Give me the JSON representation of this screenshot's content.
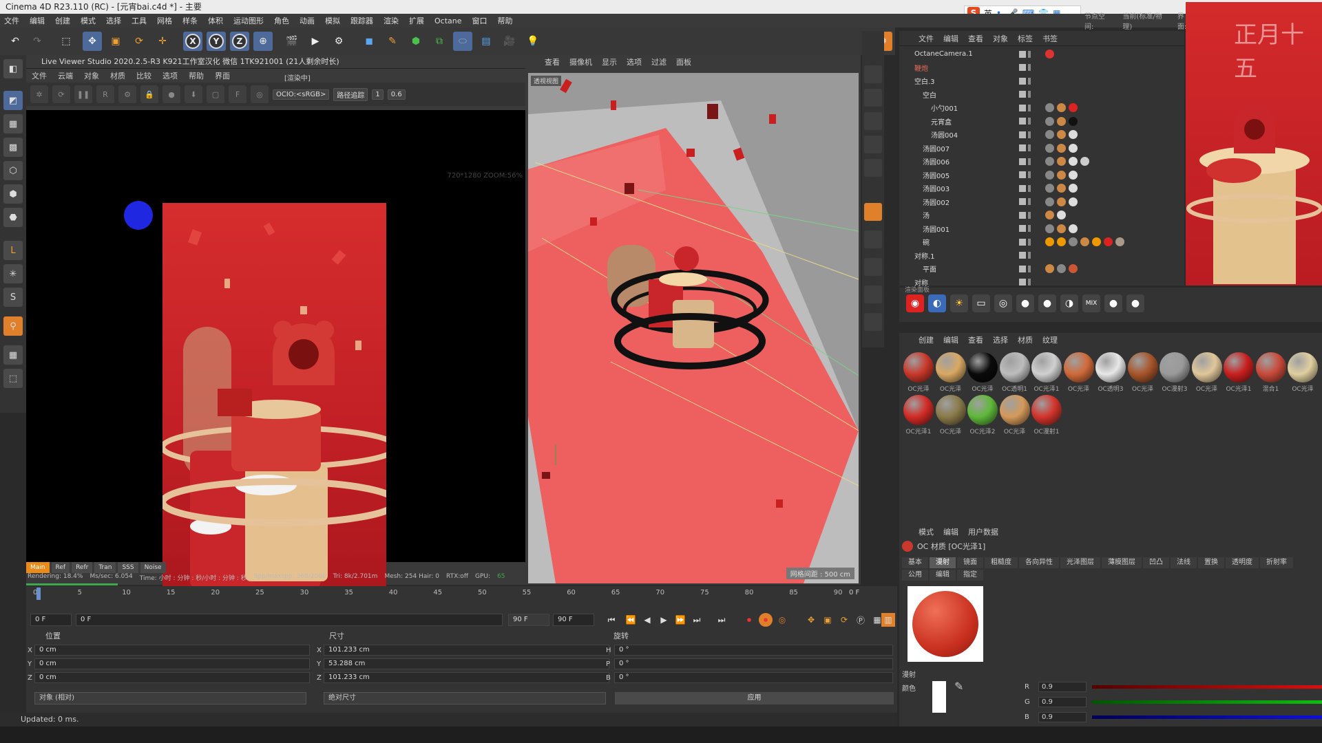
{
  "title": "Cinema 4D R23.110 (RC) - [元宵bai.c4d *] - 主要",
  "menu": [
    "文件",
    "编辑",
    "创建",
    "模式",
    "选择",
    "工具",
    "网格",
    "样条",
    "体积",
    "运动图形",
    "角色",
    "动画",
    "模拟",
    "跟踪器",
    "渲染",
    "扩展",
    "Octane",
    "窗口",
    "帮助"
  ],
  "ime": {
    "logo": "S",
    "lang": "英"
  },
  "top_right": [
    "节点空间:",
    "当前(标准/物理)",
    "界面:"
  ],
  "live_viewer": {
    "title": "Live Viewer Studio 2020.2.5-R3  K921工作室汉化 微信 1TK921001  (21人剩余时长)",
    "menu": [
      "文件",
      "云端",
      "对象",
      "材质",
      "比较",
      "选项",
      "帮助",
      "界面"
    ],
    "tag": "[渲染中]",
    "ocio": "OCIO:<sRGB>",
    "mode": "路径追踪",
    "v1": "1",
    "v2": "0.6",
    "zoom": "720*1280 ZOOM:56%",
    "tabs": [
      "Main",
      "Ref",
      "Refr",
      "Tran",
      "SSS",
      "Noise"
    ],
    "status": {
      "rendering": "Rendering: 18.4%",
      "mssec": "Ms/sec: 6.054",
      "time": "Time: 小时 : 分钟 : 秒/小时 : 分钟 : 秒",
      "spp": "Spp/maxspp: 368/2000",
      "tri": "Tri: 8k/2.701m",
      "mesh": "Mesh: 254 Hair: 0",
      "rtx": "RTX:off",
      "gpu": "GPU:",
      "gpu_val": "65"
    },
    "progress": 0.184
  },
  "viewport": {
    "menu": [
      "查看",
      "摄像机",
      "显示",
      "选项",
      "过滤",
      "面板"
    ],
    "label": "透视视图",
    "grid": "网格间距 : 500 cm"
  },
  "object_manager": {
    "menu": [
      "文件",
      "编辑",
      "查看",
      "对象",
      "标签",
      "书签"
    ],
    "rows": [
      {
        "name": "OctaneCamera.1",
        "indent": 0,
        "tags": [
          "#d33"
        ]
      },
      {
        "name": "鞭炮",
        "indent": 0,
        "tags": [],
        "color": "#e06a5a"
      },
      {
        "name": "空白.3",
        "indent": 0,
        "tags": []
      },
      {
        "name": "空白",
        "indent": 1,
        "tags": []
      },
      {
        "name": "小勺001",
        "indent": 2,
        "tags": [
          "#888",
          "#c84",
          "#d22"
        ]
      },
      {
        "name": "元宵盒",
        "indent": 2,
        "tags": [
          "#888",
          "#c84",
          "#111"
        ]
      },
      {
        "name": "汤圆004",
        "indent": 2,
        "tags": [
          "#888",
          "#c84",
          "#ddd"
        ]
      },
      {
        "name": "汤圆007",
        "indent": 1,
        "tags": [
          "#888",
          "#c84",
          "#ddd"
        ]
      },
      {
        "name": "汤圆006",
        "indent": 1,
        "tags": [
          "#888",
          "#c84",
          "#ddd",
          "#ccc"
        ]
      },
      {
        "name": "汤圆005",
        "indent": 1,
        "tags": [
          "#888",
          "#c84",
          "#ddd"
        ]
      },
      {
        "name": "汤圆003",
        "indent": 1,
        "tags": [
          "#888",
          "#c84",
          "#ddd"
        ]
      },
      {
        "name": "汤圆002",
        "indent": 1,
        "tags": [
          "#888",
          "#c84",
          "#ddd"
        ]
      },
      {
        "name": "汤",
        "indent": 1,
        "tags": [
          "#c84",
          "#ddd"
        ]
      },
      {
        "name": "汤圆001",
        "indent": 1,
        "tags": [
          "#888",
          "#c84",
          "#ddd"
        ]
      },
      {
        "name": "碗",
        "indent": 1,
        "tags": [
          "#e90",
          "#e90",
          "#888",
          "#c84",
          "#e90",
          "#d22",
          "#a98"
        ]
      },
      {
        "name": "对称.1",
        "indent": 0,
        "tags": []
      },
      {
        "name": "平面",
        "indent": 1,
        "tags": [
          "#c84",
          "#888",
          "#c53"
        ]
      },
      {
        "name": "对称",
        "indent": 0,
        "tags": []
      }
    ]
  },
  "preview_text": "正月十五",
  "mat_bar_label": "渲染面板",
  "material_manager": {
    "menu": [
      "创建",
      "编辑",
      "查看",
      "选择",
      "材质",
      "纹理"
    ],
    "items": [
      {
        "name": "OC光泽",
        "c": "#c9382a"
      },
      {
        "name": "OC光泽",
        "c": "#d9a864"
      },
      {
        "name": "OC光泽",
        "c": "#0a0a0a"
      },
      {
        "name": "OC透明1",
        "c": "#bdbdbd"
      },
      {
        "name": "OC光泽1",
        "c": "#d0d0d0"
      },
      {
        "name": "OC光泽",
        "c": "#d06a3a"
      },
      {
        "name": "OC透明3",
        "c": "#e8e8e8"
      },
      {
        "name": "OC光泽",
        "c": "#a8552a"
      },
      {
        "name": "OC漫射3",
        "c": "#9a9a9a"
      },
      {
        "name": "OC光泽",
        "c": "#e0c79a"
      },
      {
        "name": "OC光泽1",
        "c": "#c9201f"
      },
      {
        "name": "混合1",
        "c": "#c94a3a"
      },
      {
        "name": "OC光泽",
        "c": "#e0cfa0"
      },
      {
        "name": "OC光泽1",
        "c": "#d32b26"
      },
      {
        "name": "OC光泽",
        "c": "#8a7a4a"
      },
      {
        "name": "OC光泽2",
        "c": "#5fb83a"
      },
      {
        "name": "OC光泽",
        "c": "#d49a5a"
      },
      {
        "name": "OC漫射1",
        "c": "#d3342c"
      }
    ]
  },
  "attr": {
    "menu": [
      "模式",
      "编辑",
      "用户数据"
    ],
    "title": "OC 材质 [OC光泽1]",
    "tabs": [
      "基本",
      "漫射",
      "镜面",
      "粗糙度",
      "各向异性",
      "光泽图层",
      "薄膜图层",
      "凹凸",
      "法线",
      "置换",
      "透明度",
      "折射率",
      "公用",
      "编辑",
      "指定"
    ],
    "section": "漫射",
    "color_label": "颜色",
    "r": "0.9",
    "g": "0.9",
    "b": "0.9"
  },
  "timeline": {
    "ticks": [
      "0",
      "5",
      "10",
      "15",
      "20",
      "25",
      "30",
      "35",
      "40",
      "45",
      "50",
      "55",
      "60",
      "65",
      "70",
      "75",
      "80",
      "85",
      "90"
    ],
    "frame": "0 F"
  },
  "controls": {
    "start": "0 F",
    "cur": "0 F",
    "end": "90 F",
    "end2": "90 F"
  },
  "coords": {
    "h_pos": "位置",
    "h_size": "尺寸",
    "h_rot": "旋转",
    "x": "0 cm",
    "y": "0 cm",
    "z": "0 cm",
    "sx": "101.233 cm",
    "sy": "53.288 cm",
    "sz": "101.233 cm",
    "h": "0 °",
    "p": "0 °",
    "b": "0 °",
    "mode1": "对象 (相对)",
    "mode2": "绝对尺寸",
    "apply": "应用"
  },
  "status": "Updated: 0 ms."
}
